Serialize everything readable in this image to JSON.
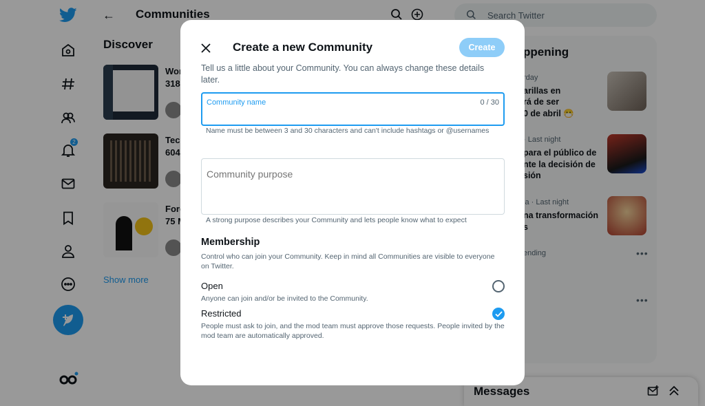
{
  "colors": {
    "accent": "#1d9bf0",
    "create_disabled": "#8ecdf8",
    "muted_text": "#536471"
  },
  "nav": {
    "items": [
      {
        "name": "twitter-logo-icon"
      },
      {
        "name": "home-icon"
      },
      {
        "name": "explore-hashtag-icon"
      },
      {
        "name": "communities-icon"
      },
      {
        "name": "notifications-icon",
        "badge": "2"
      },
      {
        "name": "messages-envelope-icon"
      },
      {
        "name": "bookmarks-icon"
      },
      {
        "name": "profile-icon"
      },
      {
        "name": "more-icon"
      }
    ],
    "compose_icon": "compose-feather-icon"
  },
  "main": {
    "title": "Communities",
    "discover_heading": "Discover",
    "cards": [
      {
        "name": "Wor",
        "count": "318"
      },
      {
        "name": "Tec",
        "count": "604"
      },
      {
        "name": "Fore",
        "count": "75 M"
      }
    ],
    "show_more": "Show more"
  },
  "sidebar": {
    "search_placeholder": "Search Twitter",
    "happening_title": "ppening",
    "trends": [
      {
        "meta": "rday",
        "lines": [
          "arillas en",
          "rá de ser",
          "0 de abril 😷"
        ]
      },
      {
        "meta": "· Last night",
        "lines": [
          "para el público de",
          "nte la decisión de",
          "sión"
        ]
      },
      {
        "meta": "ia · Last night",
        "lines": [
          "na transformación",
          "s"
        ]
      },
      {
        "meta": "ending",
        "lines": []
      }
    ],
    "messages_title": "Messages"
  },
  "modal": {
    "title": "Create a new Community",
    "create_button": "Create",
    "intro": "Tell us a little about your Community. You can always change these details later.",
    "name_field": {
      "label": "Community name",
      "counter": "0 / 30",
      "value": "",
      "help": "Name must be between 3 and 30 characters and can't include hashtags or @usernames"
    },
    "purpose_field": {
      "placeholder": "Community purpose",
      "help": "A strong purpose describes your Community and lets people know what to expect"
    },
    "membership": {
      "title": "Membership",
      "description": "Control who can join your Community. Keep in mind all Communities are visible to everyone on Twitter.",
      "options": [
        {
          "label": "Open",
          "description": "Anyone can join and/or be invited to the Community.",
          "selected": false
        },
        {
          "label": "Restricted",
          "description": "People must ask to join, and the mod team must approve those requests. People invited by the mod team are automatically approved.",
          "selected": true
        }
      ]
    }
  }
}
